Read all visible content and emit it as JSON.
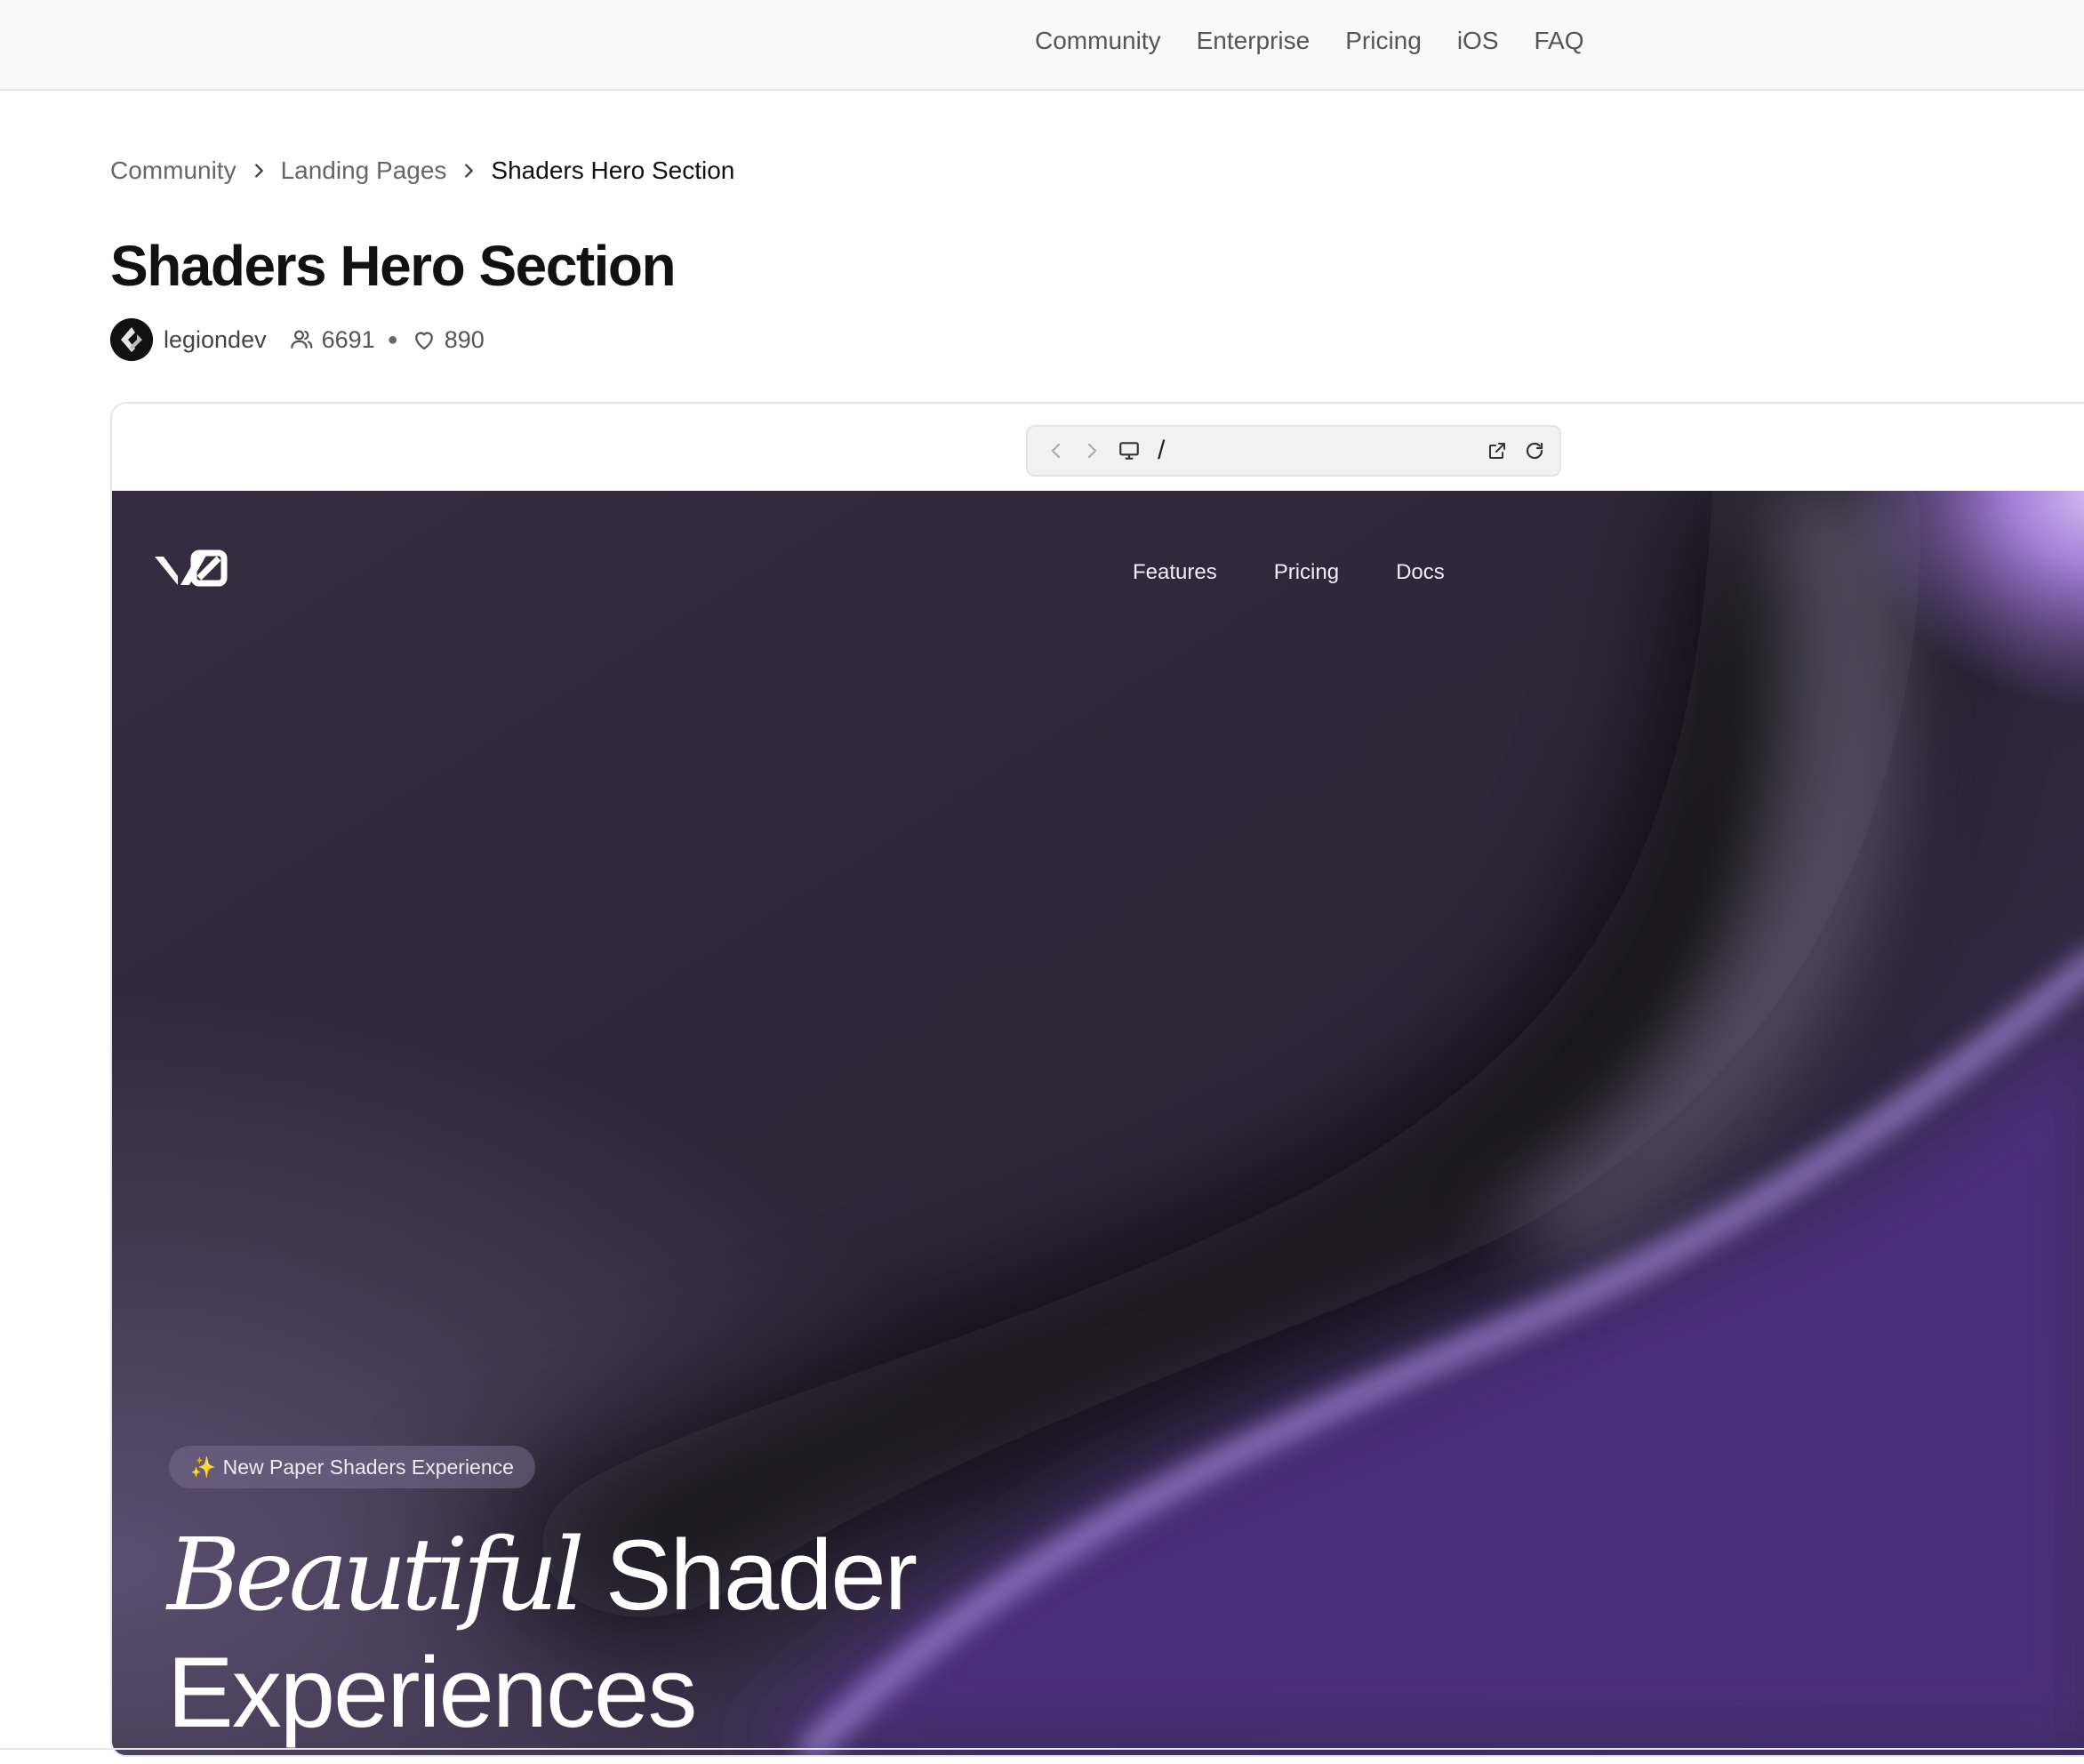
{
  "topnav": {
    "items": [
      "Community",
      "Enterprise",
      "Pricing",
      "iOS",
      "FAQ"
    ]
  },
  "breadcrumb": {
    "items": [
      "Community",
      "Landing Pages"
    ],
    "current": "Shaders Hero Section"
  },
  "page": {
    "title": "Shaders Hero Section",
    "author": "legiondev",
    "views": "6691",
    "likes": "890"
  },
  "preview": {
    "url": "/",
    "hero": {
      "nav": [
        "Features",
        "Pricing",
        "Docs"
      ],
      "badge_icon": "✨",
      "badge_text": "New Paper Shaders Experience",
      "headline_italic": "Beautiful",
      "headline_rest": " Shader",
      "headline_line2": "Experiences"
    }
  },
  "colors": {
    "hero_base": "#382e48",
    "hero_purple": "#5a3a8c",
    "hero_dark": "#0d0b10",
    "hero_highlight": "#c6aaec"
  }
}
